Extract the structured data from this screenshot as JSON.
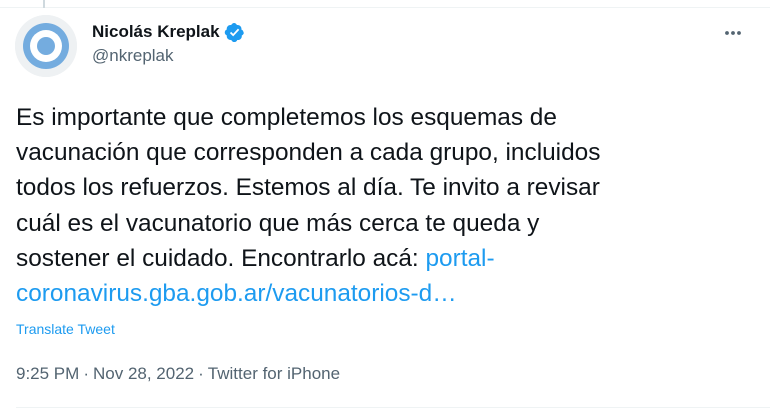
{
  "tweet": {
    "author": {
      "display_name": "Nicolás Kreplak",
      "handle": "@nkreplak",
      "verified": true,
      "avatar_icon": "argentina-flag-emblem-icon"
    },
    "text_lines": [
      "Es importante que completemos los esquemas de",
      "vacunación que corresponden a cada grupo, incluidos",
      "todos los refuerzos. Estemos al día. Te invito a revisar",
      "cuál es el vacunatorio que más cerca te queda y",
      "sostener el cuidado. Encontrarlo acá: "
    ],
    "link_line_1": "portal-",
    "link_line_2": "coronavirus.gba.gob.ar/vacunatorios-d…",
    "translate_label": "Translate Tweet",
    "time": "9:25 PM",
    "separator": "·",
    "date": "Nov 28, 2022",
    "source": "Twitter for iPhone"
  },
  "icons": {
    "verified": "verified-badge-icon",
    "more": "more-options-icon"
  },
  "colors": {
    "link": "#1d9bf0",
    "secondary_text": "#536471",
    "primary_text": "#0f1419",
    "verified_badge": "#1d9bf0",
    "avatar_blue": "#74acdf"
  }
}
